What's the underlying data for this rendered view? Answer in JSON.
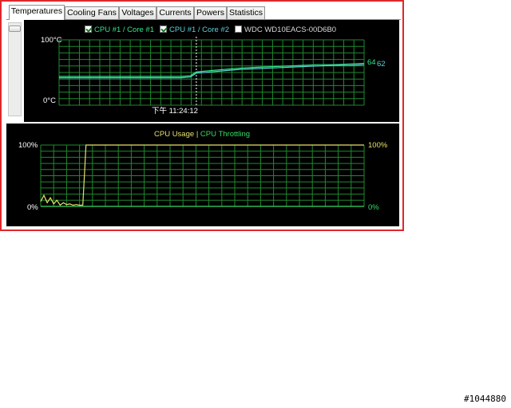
{
  "tabs": [
    {
      "label": "Temperatures",
      "active": true
    },
    {
      "label": "Cooling Fans",
      "active": false
    },
    {
      "label": "Voltages",
      "active": false
    },
    {
      "label": "Currents",
      "active": false
    },
    {
      "label": "Powers",
      "active": false
    },
    {
      "label": "Statistics",
      "active": false
    }
  ],
  "temp_panel": {
    "legend": [
      {
        "label": "CPU #1 / Core #1",
        "checked": true,
        "color": "#2fe88a"
      },
      {
        "label": "CPU #1 / Core #2",
        "checked": true,
        "color": "#5fd0d8"
      },
      {
        "label": "WDC WD10EACS-00D6B0",
        "checked": false,
        "color": "#d8d8d8"
      }
    ],
    "y_top": "100°C",
    "y_bottom": "0°C",
    "time_label": "下午 11:24:12",
    "end_values": [
      "64",
      "62"
    ]
  },
  "cpu_panel": {
    "legend_left": "CPU Usage",
    "separator": "|",
    "legend_right": "CPU Throttling",
    "left_top": "100%",
    "left_bottom": "0%",
    "right_top": "100%",
    "right_bottom": "0%"
  },
  "colors": {
    "grid": "#1f8a2e",
    "core1": "#2fe88a",
    "core2": "#5fd0d8",
    "usage": "#e8e06a",
    "throttle": "#33dd66",
    "frame": "#e0262b"
  },
  "watermark": "#1044880",
  "chart_data": [
    {
      "type": "line",
      "title": "",
      "ylabel": "",
      "ylim": [
        0,
        100
      ],
      "y_tick_labels": [
        "100°C",
        "0°C"
      ],
      "x_tick_labels": [
        "下午 11:24:12"
      ],
      "series": [
        {
          "name": "CPU #1 / Core #1",
          "x": [
            0,
            10,
            20,
            30,
            40,
            43,
            45,
            50,
            55,
            60,
            65,
            70,
            75,
            80,
            85,
            90,
            95,
            100
          ],
          "values": [
            44,
            44,
            44,
            44,
            44,
            45,
            51,
            53,
            55,
            57,
            58,
            59,
            60,
            61,
            62,
            62,
            63,
            64
          ]
        },
        {
          "name": "CPU #1 / Core #2",
          "x": [
            0,
            10,
            20,
            30,
            40,
            43,
            45,
            50,
            55,
            60,
            65,
            70,
            75,
            80,
            85,
            90,
            95,
            100
          ],
          "values": [
            42,
            42,
            42,
            42,
            42,
            43,
            49,
            51,
            53,
            55,
            56,
            57,
            58,
            59,
            60,
            61,
            61,
            62
          ]
        }
      ]
    },
    {
      "type": "line",
      "title": "",
      "ylabel": "",
      "ylim": [
        0,
        100
      ],
      "y_tick_labels": [
        "100%",
        "0%"
      ],
      "series": [
        {
          "name": "CPU Usage",
          "x": [
            0,
            1,
            2,
            3,
            4,
            5,
            6,
            7,
            8,
            9,
            10,
            11,
            12,
            13,
            13.5,
            14,
            100
          ],
          "values": [
            8,
            18,
            6,
            14,
            4,
            10,
            2,
            6,
            3,
            4,
            2,
            3,
            2,
            2,
            50,
            100,
            100
          ]
        },
        {
          "name": "CPU Throttling",
          "x": [
            0,
            100
          ],
          "values": [
            0,
            0
          ]
        }
      ]
    }
  ]
}
